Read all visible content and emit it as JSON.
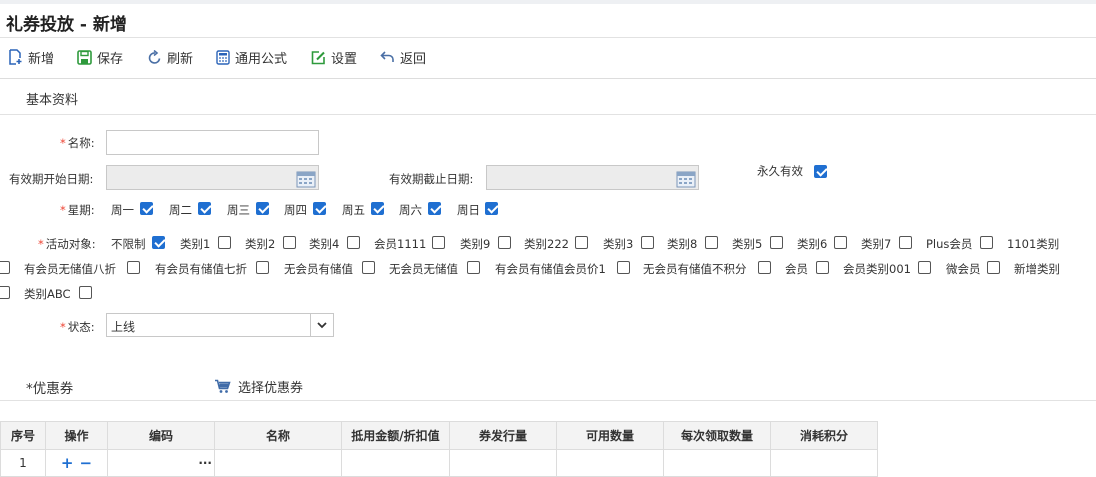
{
  "page_title": "礼券投放 - 新增",
  "toolbar": {
    "new_label": "新增",
    "save_label": "保存",
    "refresh_label": "刷新",
    "formula_label": "通用公式",
    "settings_label": "设置",
    "back_label": "返回"
  },
  "section_basic": "基本资料",
  "form": {
    "required_mark": "*",
    "name_label": "名称:",
    "name_value": "",
    "start_label": "有效期开始日期:",
    "end_label": "有效期截止日期:",
    "forever_label": "永久有效",
    "forever_checked": true,
    "week_label": "星期:",
    "weekdays": [
      {
        "label": "周一",
        "checked": true
      },
      {
        "label": "周二",
        "checked": true
      },
      {
        "label": "周三",
        "checked": true
      },
      {
        "label": "周四",
        "checked": true
      },
      {
        "label": "周五",
        "checked": true
      },
      {
        "label": "周六",
        "checked": true
      },
      {
        "label": "周日",
        "checked": true
      }
    ],
    "target_label": "活动对象:",
    "targets": [
      {
        "label": "不限制",
        "checked": true
      },
      {
        "label": "类别1",
        "checked": false
      },
      {
        "label": "类别2",
        "checked": false
      },
      {
        "label": "类别4",
        "checked": false
      },
      {
        "label": "会员1111",
        "checked": false
      },
      {
        "label": "类别9",
        "checked": false
      },
      {
        "label": "类别222",
        "checked": false
      },
      {
        "label": "类别3",
        "checked": false
      },
      {
        "label": "类别8",
        "checked": false
      },
      {
        "label": "类别5",
        "checked": false
      },
      {
        "label": "类别6",
        "checked": false
      },
      {
        "label": "类别7",
        "checked": false
      },
      {
        "label": "Plus会员",
        "checked": false
      },
      {
        "label": "1101类别",
        "checked": false
      },
      {
        "label": "有会员无储值八折",
        "checked": false
      },
      {
        "label": "有会员有储值七折",
        "checked": false
      },
      {
        "label": "无会员有储值",
        "checked": false
      },
      {
        "label": "无会员无储值",
        "checked": false
      },
      {
        "label": "有会员有储值会员价1",
        "checked": false
      },
      {
        "label": "无会员有储值不积分",
        "checked": false
      },
      {
        "label": "会员",
        "checked": false
      },
      {
        "label": "会员类别001",
        "checked": false
      },
      {
        "label": "微会员",
        "checked": false
      },
      {
        "label": "新增类别",
        "checked": false
      },
      {
        "label": "类别ABC",
        "checked": false
      }
    ],
    "status_label": "状态:",
    "status_value": "上线"
  },
  "coupon_section": {
    "title": "*优惠券",
    "pick_label": "选择优惠券"
  },
  "table": {
    "headers": [
      "序号",
      "操作",
      "编码",
      "名称",
      "抵用金额/折扣值",
      "券发行量",
      "可用数量",
      "每次领取数量",
      "消耗积分"
    ],
    "rows": [
      {
        "index": "1",
        "ops_add": "+",
        "ops_remove": "−",
        "code_more": "···"
      }
    ]
  },
  "colors": {
    "accent": "#1f6fd1",
    "required": "#e43"
  }
}
